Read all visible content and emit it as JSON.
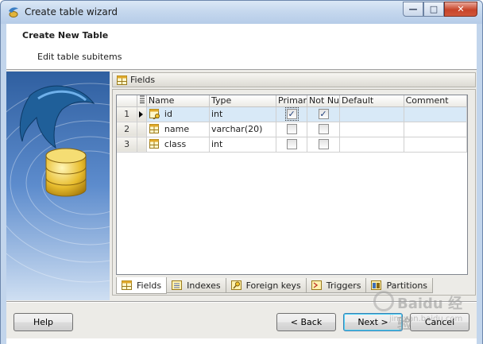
{
  "window": {
    "title": "Create table wizard",
    "buttons": {
      "minimize": "—",
      "maximize": "□",
      "close": "✕"
    }
  },
  "header": {
    "title": "Create New Table",
    "subtitle": "Edit table subitems"
  },
  "section": {
    "label": "Fields"
  },
  "grid": {
    "columns": [
      "Name",
      "Type",
      "Primar",
      "Not Nu",
      "Default",
      "Comment"
    ],
    "rows": [
      {
        "num": "1",
        "name": "id",
        "type": "int",
        "primary": true,
        "not_null": true,
        "default": "",
        "comment": ""
      },
      {
        "num": "2",
        "name": "name",
        "type": "varchar(20)",
        "primary": false,
        "not_null": false,
        "default": "",
        "comment": ""
      },
      {
        "num": "3",
        "name": "class",
        "type": "int",
        "primary": false,
        "not_null": false,
        "default": "",
        "comment": ""
      }
    ],
    "selected_row": 0
  },
  "tabs": [
    "Fields",
    "Indexes",
    "Foreign keys",
    "Triggers",
    "Partitions"
  ],
  "footer": {
    "help": "Help",
    "back": "< Back",
    "next": "Next >",
    "cancel": "Cancel"
  },
  "watermark": {
    "brand": "Baidu 经验",
    "url": "jingyan.baidu.com"
  }
}
